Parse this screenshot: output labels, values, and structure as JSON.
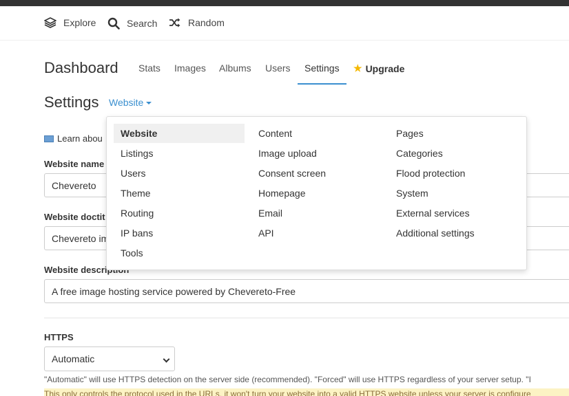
{
  "topnav": {
    "explore": "Explore",
    "search": "Search",
    "random": "Random"
  },
  "dashboard": {
    "title": "Dashboard",
    "tabs": [
      "Stats",
      "Images",
      "Albums",
      "Users",
      "Settings"
    ],
    "active_tab": "Settings",
    "upgrade": "Upgrade"
  },
  "settings": {
    "title": "Settings",
    "section_selector": "Website",
    "learn_text": "Learn abou"
  },
  "form": {
    "website_name_label": "Website name",
    "website_name_value": "Chevereto",
    "website_doctitle_label": "Website doctit",
    "website_doctitle_value": "Chevereto im",
    "website_description_label": "Website description",
    "website_description_value": "A free image hosting service powered by Chevereto-Free",
    "https_label": "HTTPS",
    "https_value": "Automatic",
    "https_help": "\"Automatic\" will use HTTPS detection on the server side (recommended). \"Forced\" will use HTTPS regardless of your server setup. \"I",
    "https_warning": "This only controls the protocol used in the URLs, it won't turn your website into a valid HTTPS website unless your server is configure"
  },
  "dropdown": {
    "col1": [
      "Website",
      "Listings",
      "Users",
      "Theme",
      "Routing",
      "IP bans",
      "Tools"
    ],
    "col2": [
      "Content",
      "Image upload",
      "Consent screen",
      "Homepage",
      "Email",
      "API"
    ],
    "col3": [
      "Pages",
      "Categories",
      "Flood protection",
      "System",
      "External services",
      "Additional settings"
    ],
    "selected": "Website"
  },
  "colors": {
    "accent": "#3a8fcf",
    "star": "#f5b800",
    "warning_bg": "#fcf3c4"
  },
  "icons": {
    "explore": "layers-icon",
    "search": "search-icon",
    "random": "shuffle-icon",
    "upgrade": "star-icon",
    "learn": "book-icon"
  }
}
